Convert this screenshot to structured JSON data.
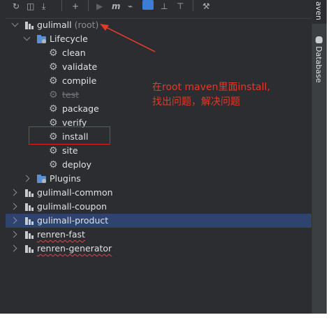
{
  "sidebar": {
    "maven_tab_label": "aven",
    "database_tab_label": "Database"
  },
  "tree": {
    "root": {
      "label": "gulimall",
      "suffix": "(root)"
    },
    "lifecycle": {
      "label": "Lifecycle",
      "phases": [
        "clean",
        "validate",
        "compile",
        "test",
        "package",
        "verify",
        "install",
        "site",
        "deploy"
      ],
      "skipped_phase": "test"
    },
    "plugins": {
      "label": "Plugins"
    },
    "modules": [
      "gulimall-common",
      "gulimall-coupon",
      "gulimall-product",
      "renren-fast",
      "renren-generator"
    ],
    "selected_module": "gulimall-product"
  },
  "annotation": {
    "line1": "在root maven里面install,",
    "line2": "找出问题，解决问题",
    "color": "#e03a2b"
  },
  "colors": {
    "panel_bg": "#2b2d30",
    "selected_row": "#2e436e",
    "text": "#dfe1e5",
    "gear": "#b4b8bf",
    "module_icon": "#c9ccce",
    "lifecycle_icon": "#5a8fd6",
    "highlight_box": "#e0221c"
  },
  "toolbar_icons": [
    "refresh-icon",
    "generate-sources-icon",
    "download-icon",
    "add-icon",
    "run-icon",
    "execute-goal-icon",
    "toggle-offline-icon",
    "skip-tests-icon",
    "show-dependencies-icon",
    "collapse-all-icon",
    "settings-icon"
  ]
}
